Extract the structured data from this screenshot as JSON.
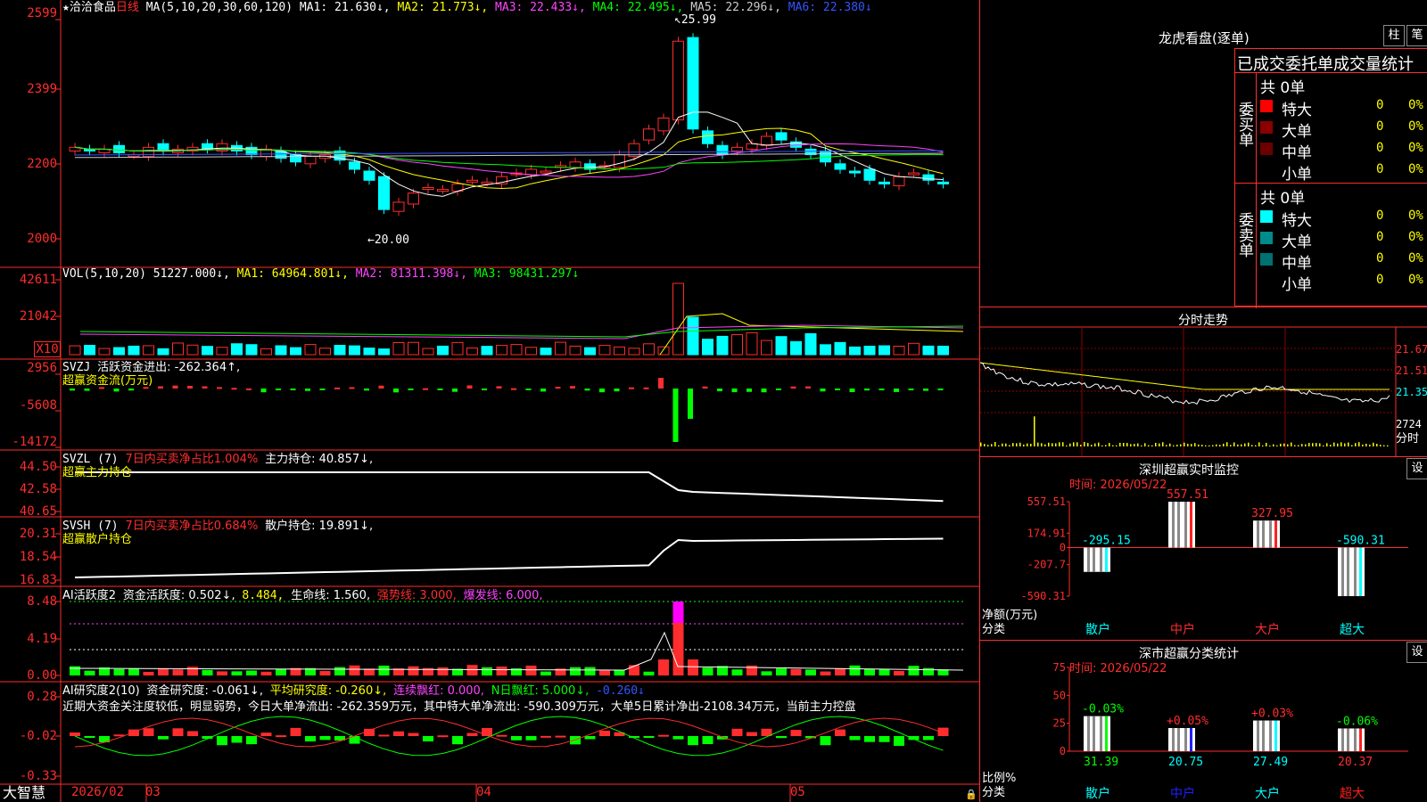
{
  "header": {
    "star": "★",
    "stock_name": "洽洽食品",
    "period": "日线",
    "ma_params": "MA(5,10,20,30,60,120)",
    "ma1": "MA1: 21.630↓,",
    "ma2": "MA2: 21.773↓,",
    "ma3": "MA3: 22.433↓,",
    "ma4": "MA4: 22.495↓,",
    "ma5": "MA5: 22.296↓,",
    "ma6": "MA6: 22.380↓"
  },
  "price_axis": [
    "2599",
    "2399",
    "2200",
    "2000"
  ],
  "price_annotations": {
    "high": "25.99",
    "low": "20.00"
  },
  "vol": {
    "params": "VOL(5,10,20)",
    "value": "51227.000↓,",
    "ma1": "MA1: 64964.801↓,",
    "ma2": "MA2: 81311.398↓,",
    "ma3": "MA3: 98431.297↓",
    "axis": [
      "42611",
      "21042"
    ],
    "unit": "X10"
  },
  "svzj": {
    "line1_name": "SVZJ",
    "line1_text": "活跃资金进出: -262.364↑,",
    "line2": "超赢资金流(万元)",
    "axis": [
      "2956",
      "-5608",
      "-14172"
    ]
  },
  "svzl": {
    "name": "SVZL (7)",
    "ratio": "7日内买卖净占比1.004%",
    "hold": "主力持仓: 40.857↓,",
    "line2": "超赢主力持仓",
    "axis": [
      "44.50",
      "42.58",
      "40.65"
    ]
  },
  "svsh": {
    "name": "SVSH (7)",
    "ratio": "7日内买卖净占比0.684%",
    "hold": "散户持仓: 19.891↓,",
    "line2": "超赢散户持仓",
    "axis": [
      "20.31",
      "18.54",
      "16.83"
    ]
  },
  "ai_active": {
    "name": "AI活跃度2",
    "t1": "资金活跃度: 0.502↓,",
    "t2": "8.484,",
    "t3": "生命线: 1.560,",
    "t4": "强势线: 3.000,",
    "t5": "爆发线: 6.000,",
    "axis": [
      "8.48",
      "4.19",
      "0.00"
    ]
  },
  "ai_research": {
    "name": "AI研究度2(10)",
    "t1": "资金研究度: -0.061↓,",
    "t2": "平均研究度: -0.260↓,",
    "t3": "连续飘红: 0.000,",
    "t4": "N日飘红: 5.000↓,",
    "t5": "-0.260↓",
    "comment": "近期大资金关注度较低，明显弱势，今日大单净流出: -262.359万元，其中特大单净流出: -590.309万元，大单5日累计净出-2108.34万元，当前主力控盘",
    "axis": [
      "0.28",
      "-0.02",
      "-0.33"
    ]
  },
  "bottom_bar": {
    "brand": "大智慧",
    "dates": [
      "2026/02",
      "03",
      "04",
      "05"
    ]
  },
  "longhu": {
    "title": "龙虎看盘(逐单)",
    "btn_zhu": "柱",
    "btn_bi": "笔",
    "subtitle": "已成交委托单成交量统计",
    "buy": {
      "side_label": "委买单",
      "total": "共 0单",
      "rows": [
        {
          "label": "特大",
          "count": "0",
          "pct": "0%",
          "color": "#ff0000"
        },
        {
          "label": "大单",
          "count": "0",
          "pct": "0%",
          "color": "#8b0000"
        },
        {
          "label": "中单",
          "count": "0",
          "pct": "0%",
          "color": "#6b0000"
        },
        {
          "label": "小单",
          "count": "0",
          "pct": "0%",
          "color": ""
        }
      ]
    },
    "sell": {
      "side_label": "委卖单",
      "total": "共 0单",
      "rows": [
        {
          "label": "特大",
          "count": "0",
          "pct": "0%",
          "color": "#00ffff"
        },
        {
          "label": "大单",
          "count": "0",
          "pct": "0%",
          "color": "#008b8b"
        },
        {
          "label": "中单",
          "count": "0",
          "pct": "0%",
          "color": "#007070"
        },
        {
          "label": "小单",
          "count": "0",
          "pct": "0%",
          "color": ""
        }
      ]
    }
  },
  "intraday": {
    "title": "分时走势",
    "axis": [
      "21.67",
      "21.51",
      "21.35",
      "2724"
    ],
    "unit": "分时"
  },
  "sz_monitor": {
    "title": "深圳超赢实时监控",
    "btn": "设",
    "time": "时间: 2026/05/22",
    "axis": [
      "557.51",
      "174.91",
      "0",
      "-207.7",
      "-590.31"
    ],
    "ylabel": "净额(万元)",
    "xlabel": "分类",
    "categories": [
      "散户",
      "中户",
      "大户",
      "超大"
    ],
    "values": [
      -295.15,
      557.51,
      327.95,
      -590.31
    ],
    "value_labels": [
      "-295.15",
      "557.51",
      "327.95",
      "-590.31"
    ]
  },
  "sz_stats": {
    "title": "深市超赢分类统计",
    "btn": "设",
    "time": "时间: 2026/05/22",
    "axis": [
      "75",
      "50",
      "25",
      "0"
    ],
    "ylabel": "比例%",
    "xlabel": "分类",
    "categories": [
      "散户",
      "中户",
      "大户",
      "超大"
    ],
    "values": [
      31.39,
      20.75,
      27.49,
      20.37
    ],
    "changes": [
      "-0.03%",
      "+0.05%",
      "+0.03%",
      "-0.06%"
    ],
    "change_colors": [
      "#00ff00",
      "#ff2d2d",
      "#ff2d2d",
      "#00ff00"
    ],
    "bar_colors": [
      "#00ff00",
      "#2020ff",
      "#00ffff",
      "#ff2020"
    ],
    "cat_colors": [
      "#00ffff",
      "#2020ff",
      "#00ffff",
      "#ff2020"
    ],
    "value_colors": [
      "#00ff00",
      "#00ffff",
      "#00ffff",
      "#ff2d2d"
    ]
  },
  "chart_data": [
    {
      "type": "bar",
      "title": "深圳超赢实时监控",
      "categories": [
        "散户",
        "中户",
        "大户",
        "超大"
      ],
      "values": [
        -295.15,
        557.51,
        327.95,
        -590.31
      ],
      "ylabel": "净额(万元)",
      "xlabel": "分类",
      "ylim": [
        -590.31,
        557.51
      ]
    },
    {
      "type": "bar",
      "title": "深市超赢分类统计",
      "categories": [
        "散户",
        "中户",
        "大户",
        "超大"
      ],
      "values": [
        31.39,
        20.75,
        27.49,
        20.37
      ],
      "ylabel": "比例%",
      "xlabel": "分类",
      "ylim": [
        0,
        75
      ]
    },
    {
      "type": "line",
      "title": "",
      "ylim": [
        20.0,
        25.99
      ],
      "y_ticks": [
        20.0,
        22.0,
        23.99,
        25.99
      ],
      "annotations": {
        "high": 25.99,
        "low": 20.0
      },
      "series_note_only_visible_values": true
    }
  ]
}
